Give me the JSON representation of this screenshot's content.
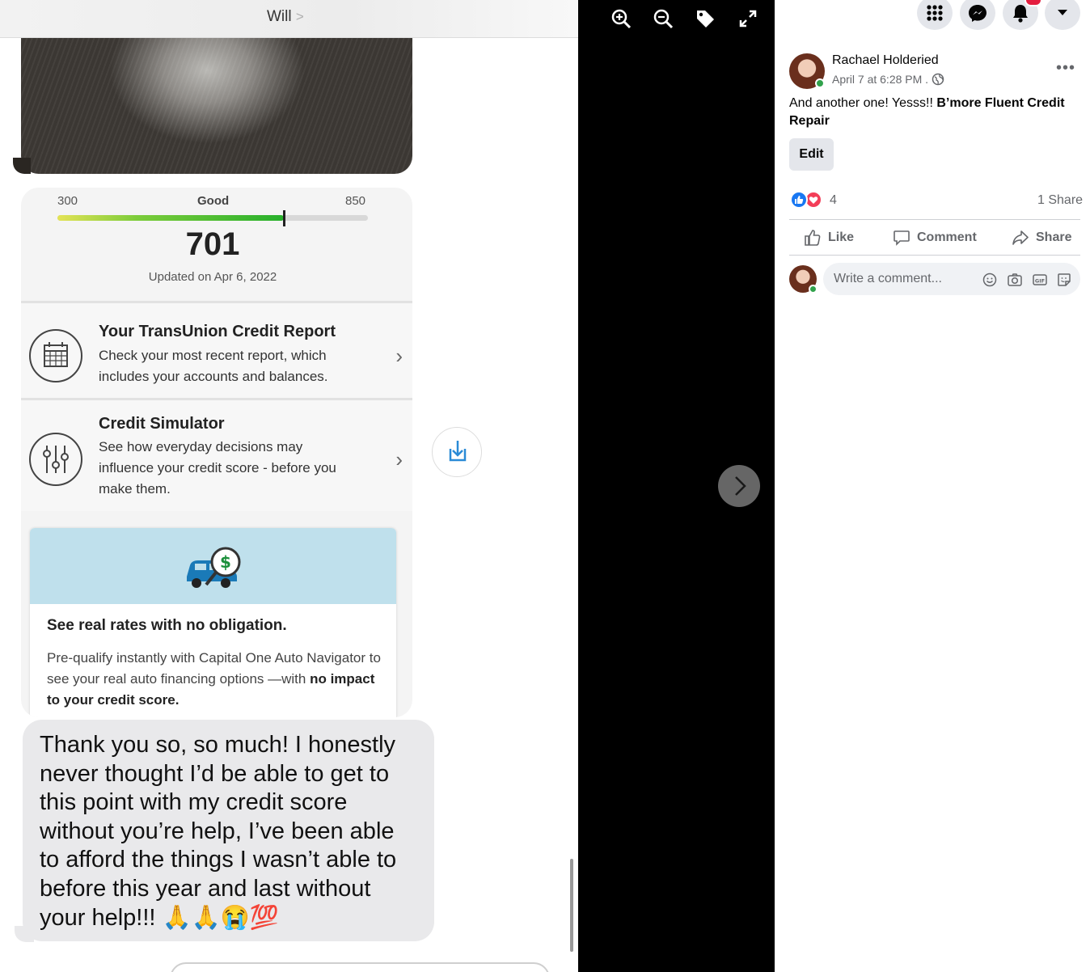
{
  "photo": {
    "contact_name": "Will",
    "contact_chevron": ">",
    "credit_card": {
      "scale_min": "300",
      "rating": "Good",
      "scale_max": "850",
      "score": "701",
      "score_fraction": 0.73,
      "updated": "Updated on Apr 6, 2022",
      "rows": [
        {
          "title": "Your TransUnion Credit Report",
          "line1": "Check your most recent report, which",
          "line2": "includes your accounts and balances.",
          "line3": "",
          "icon": "calendar-icon"
        },
        {
          "title": "Credit Simulator",
          "line1": "See how everyday decisions may",
          "line2": "influence your credit score - before you",
          "line3": "make them.",
          "icon": "sliders-icon"
        }
      ],
      "chevron": "›",
      "promo": {
        "title": "See real rates with no obligation.",
        "text_plain": "Pre-qualify instantly with Capital One Auto Navigator to see your real auto financing options —with ",
        "text_bold": "no impact to your credit score.",
        "icon": "car-dollar-icon"
      }
    },
    "thanks_message": "Thank you so, so much! I honestly never thought I’d be able to get to this point with my credit score without you’re help, I’ve been able to afford the things I wasn’t able to before this year and last without your help!!! 🙏🙏😭💯"
  },
  "viewer": {
    "tools": [
      "zoom-in-icon",
      "zoom-out-icon",
      "tag-icon",
      "fullscreen-icon"
    ],
    "next": "next-photo-icon"
  },
  "fb": {
    "top_buttons": [
      "menu-grid-icon",
      "messenger-icon",
      "notifications-icon",
      "account-caret-icon"
    ],
    "author": "Rachael Holderied",
    "timestamp": "April 7 at 6:28 PM .",
    "post_text_plain": "And another one! Yesss!! ",
    "post_page_link": "B’more Fluent Credit Repair",
    "edit_label": "Edit",
    "reaction_count": "4",
    "share_count": "1 Share",
    "actions": {
      "like": "Like",
      "comment": "Comment",
      "share": "Share"
    },
    "comment_placeholder": "Write a comment...",
    "colors": {
      "accent": "#1877f2",
      "online": "#31a24c",
      "badge": "#e41e3f"
    }
  }
}
